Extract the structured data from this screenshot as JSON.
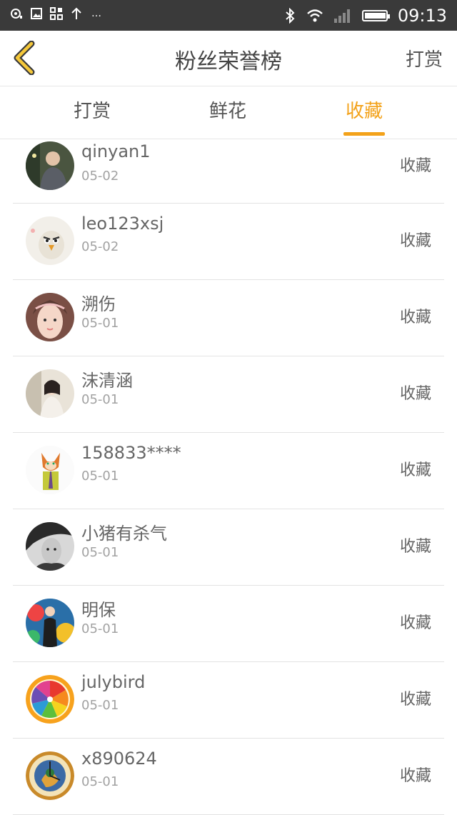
{
  "status_bar": {
    "time": "09:13",
    "left_icons": [
      "camera-icon",
      "image-icon",
      "app-grid-icon",
      "upload-icon",
      "more-icon"
    ],
    "right_icons": [
      "bluetooth-icon",
      "wifi-icon",
      "signal-icon",
      "battery-icon"
    ],
    "battery_level": 0.9
  },
  "header": {
    "title": "粉丝荣誉榜",
    "right_label": "打赏"
  },
  "tabs": [
    {
      "label": "打赏",
      "active": false
    },
    {
      "label": "鲜花",
      "active": false
    },
    {
      "label": "收藏",
      "active": true
    }
  ],
  "accent_color": "#f3a21a",
  "list": [
    {
      "name": "qinyan1",
      "date": "05-02",
      "action": "收藏",
      "avatar": "person-photo-avatar"
    },
    {
      "name": "leo123xsj",
      "date": "05-02",
      "action": "收藏",
      "avatar": "angry-bird-avatar"
    },
    {
      "name": "溯伤",
      "date": "05-01",
      "action": "收藏",
      "avatar": "girl-photo-avatar"
    },
    {
      "name": "沫清涵",
      "date": "05-01",
      "action": "收藏",
      "avatar": "girl-photo-avatar"
    },
    {
      "name": "158833****",
      "date": "05-01",
      "action": "收藏",
      "avatar": "fox-cartoon-avatar"
    },
    {
      "name": "小猪有杀气",
      "date": "05-01",
      "action": "收藏",
      "avatar": "man-bw-photo-avatar"
    },
    {
      "name": "明保",
      "date": "05-01",
      "action": "收藏",
      "avatar": "graffiti-photo-avatar"
    },
    {
      "name": "julybird",
      "date": "05-01",
      "action": "收藏",
      "avatar": "rainbow-citrus-avatar"
    },
    {
      "name": "x890624",
      "date": "05-01",
      "action": "收藏",
      "avatar": "clock-badge-avatar"
    }
  ]
}
